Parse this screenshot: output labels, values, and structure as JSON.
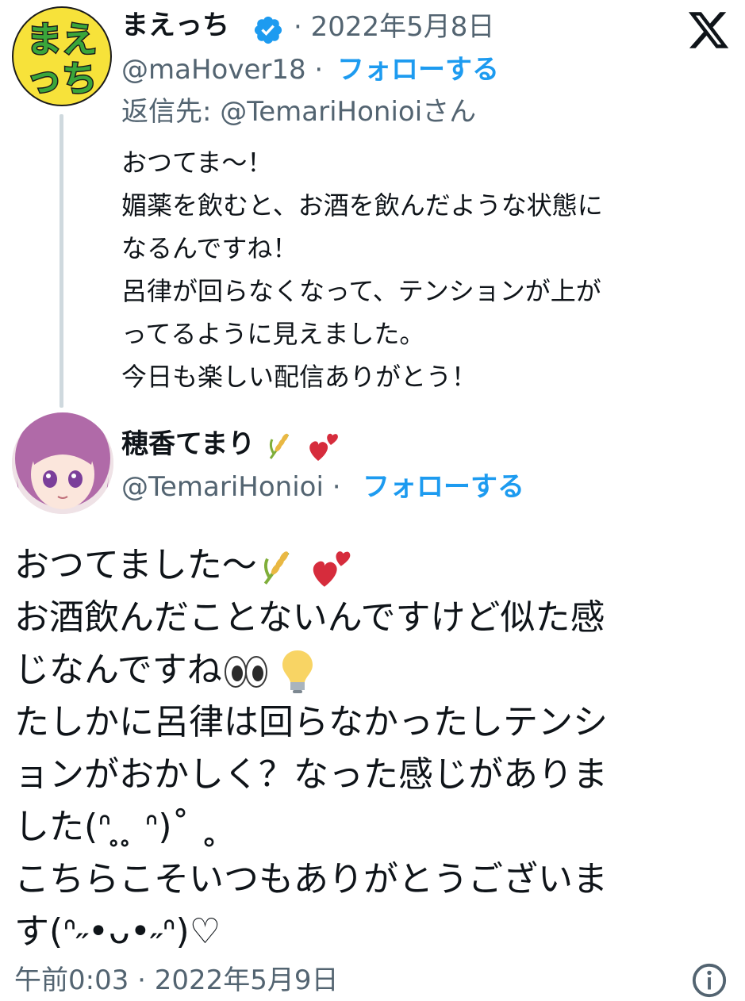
{
  "reply": {
    "author_name": "まえっち",
    "avatar_text": [
      "まえ",
      "っち"
    ],
    "verified": true,
    "date": "· 2022年5月8日",
    "handle": "@maHover18 ·",
    "follow_label": "フォローする",
    "reply_to": "返信先: @TemariHonioiさん",
    "lines": [
      "おつてま～！",
      "媚薬を飲むと、お酒を飲んだような状態に",
      "なるんですね！",
      "呂律が回らなくなって、テンションが上が",
      "ってるように見えました。",
      "今日も楽しい配信ありがとう！"
    ]
  },
  "main": {
    "author_name": "穂香てまり",
    "handle": "@TemariHonioi ·",
    "follow_label": "フォローする",
    "line1": "おつてました～",
    "lines": [
      "お酒飲んだことないんですけど似た感",
      "じなんですね",
      "たしかに呂律は回らなかったしテンシ",
      "ョンがおかしく？なった感じがありま",
      "した(ᐢ ̥ ̥ ᐢ)˚ ˳",
      "こちらこそいつもありがとうございま",
      "す(ᐢ˶•ᴗ•˶ᐢ)♡"
    ],
    "timestamp": "午前0:03 · 2022年5月9日"
  },
  "icons": {
    "verified": "verified-badge-icon",
    "x_logo": "x-logo-icon",
    "info": "info-icon",
    "wheat": "wheat-emoji",
    "hearts": "two-hearts-emoji",
    "eyes": "eyes-emoji",
    "bulb": "light-bulb-emoji"
  },
  "colors": {
    "link": "#1d9bf0",
    "muted": "#536471",
    "text": "#0f1419",
    "verified": "#1d9bf0",
    "avatar_bg": "#f7e23a",
    "avatar_text": "#3aa63a"
  }
}
